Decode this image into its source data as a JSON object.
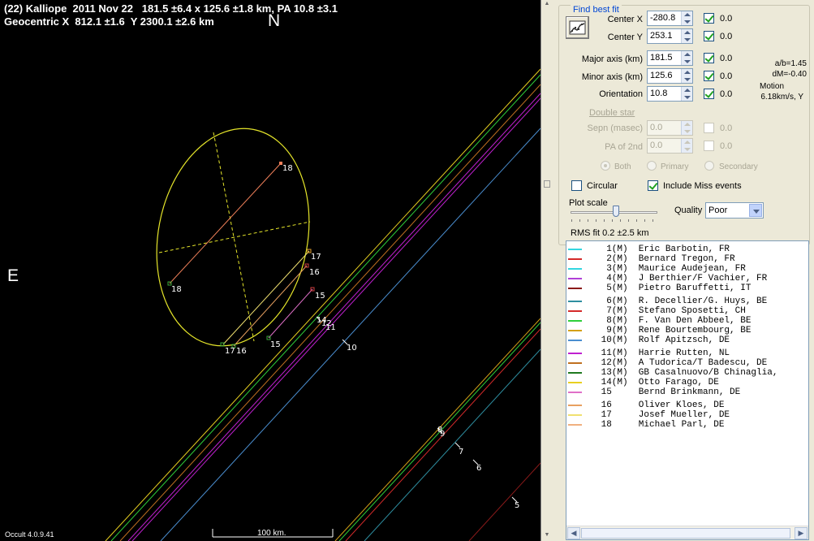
{
  "plot": {
    "header_line1": "(22) Kalliope  2011 Nov 22   181.5 ±6.4 x 125.6 ±1.8 km, PA 10.8 ±3.1",
    "header_line2": "Geocentric X  812.1 ±1.6  Y 2300.1 ±2.6 km",
    "north": "N",
    "east": "E",
    "version": "Occult 4.0.9.41",
    "scale_label": "100 km.",
    "chord_labels": [
      "18",
      "18",
      "17",
      "16",
      "15",
      "17",
      "16",
      "15",
      "14",
      "12",
      "11",
      "10",
      "9",
      "8",
      "7",
      "6",
      "5"
    ]
  },
  "panel": {
    "group_title": "Find best fit",
    "fields": {
      "center_x": {
        "label": "Center X",
        "value": "-280.8",
        "check": "0.0"
      },
      "center_y": {
        "label": "Center Y",
        "value": "253.1",
        "check": "0.0"
      },
      "major_axis": {
        "label": "Major axis (km)",
        "value": "181.5",
        "check": "0.0"
      },
      "minor_axis": {
        "label": "Minor axis (km)",
        "value": "125.6",
        "check": "0.0"
      },
      "orientation": {
        "label": "Orientation",
        "value": "10.8",
        "check": "0.0"
      }
    },
    "side_info": {
      "ab": "a/b=1.45",
      "dm": "dM=-0.40",
      "motion_label": "Motion",
      "motion_value": "6.18km/s, Y"
    },
    "double_star": {
      "title": "Double star",
      "sepn": {
        "label": "Sepn (masec)",
        "value": "0.0",
        "check": "0.0"
      },
      "pa2": {
        "label": "PA of 2nd",
        "value": "0.0",
        "check": "0.0"
      },
      "radios": [
        "Both",
        "Primary",
        "Secondary"
      ]
    },
    "circular_label": "Circular",
    "include_miss_label": "Include Miss events",
    "plot_scale_label": "Plot scale",
    "quality_label": "Quality",
    "quality_value": "Poor",
    "rms": "RMS fit 0.2 ±2.5 km"
  },
  "observers": [
    {
      "text": "  1(M)  Eric Barbotin, FR",
      "color": "#33d6e0"
    },
    {
      "text": "  2(M)  Bernard Tregon, FR",
      "color": "#d42a2a"
    },
    {
      "text": "  3(M)  Maurice Audejean, FR",
      "color": "#33d6e0"
    },
    {
      "text": "  4(M)  J Berthier/F Vachier, FR",
      "color": "#b040d8"
    },
    {
      "text": "  5(M)  Pietro Baruffetti, IT",
      "color": "#8b1a1a"
    },
    {
      "text": "  6(M)  R. Decellier/G. Huys, BE",
      "color": "#2e8ea0"
    },
    {
      "text": "  7(M)  Stefano Sposetti, CH",
      "color": "#d42a2a"
    },
    {
      "text": "  8(M)  F. Van Den Abbeel, BE",
      "color": "#2ecf3a"
    },
    {
      "text": "  9(M)  Rene Bourtembourg, BE",
      "color": "#d4a017"
    },
    {
      "text": " 10(M)  Rolf Apitzsch, DE",
      "color": "#4a8ed0"
    },
    {
      "text": " 11(M)  Harrie Rutten, NL",
      "color": "#c020d0"
    },
    {
      "text": " 12(M)  A Tudorica/T Badescu, DE",
      "color": "#c07020"
    },
    {
      "text": " 13(M)  GB Casalnuovo/B Chinaglia,",
      "color": "#1f7a1f"
    },
    {
      "text": " 14(M)  Otto Farago, DE",
      "color": "#e8d020"
    },
    {
      "text": " 15     Bernd Brinkmann, DE",
      "color": "#e070c8"
    },
    {
      "text": " 16     Oliver Kloes, DE",
      "color": "#e8a060"
    },
    {
      "text": " 17     Josef Mueller, DE",
      "color": "#f0e070"
    },
    {
      "text": " 18     Michael Parl, DE",
      "color": "#f0b080"
    }
  ]
}
